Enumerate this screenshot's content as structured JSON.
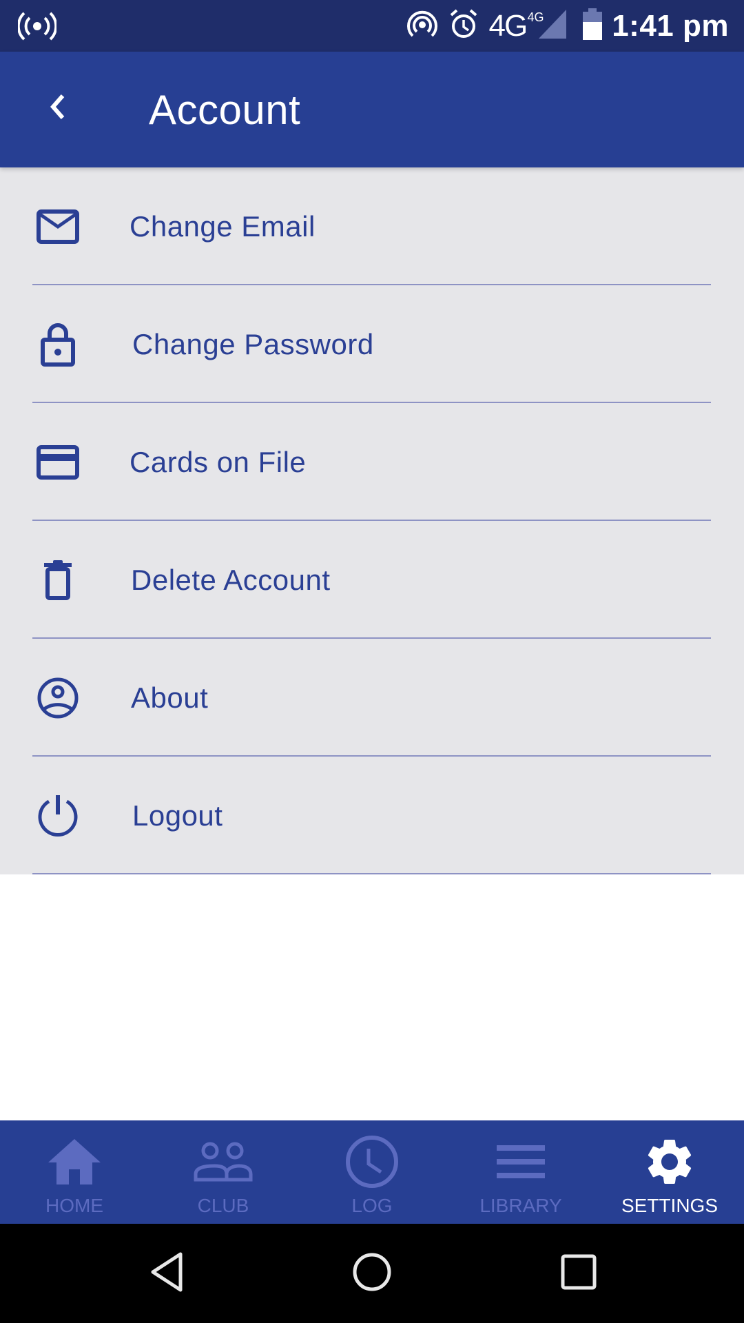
{
  "status_bar": {
    "time": "1:41 pm",
    "network": "4G",
    "network_sup": "4G",
    "icons": [
      "broadcast-icon",
      "hotspot-icon",
      "alarm-icon",
      "signal-icon",
      "battery-icon"
    ]
  },
  "app_bar": {
    "title": "Account",
    "back_icon": "chevron-left-icon"
  },
  "menu": {
    "items": [
      {
        "label": "Change Email",
        "icon": "mail-icon"
      },
      {
        "label": "Change Password",
        "icon": "lock-icon"
      },
      {
        "label": "Cards on File",
        "icon": "credit-card-icon"
      },
      {
        "label": "Delete Account",
        "icon": "trash-icon"
      },
      {
        "label": "About",
        "icon": "user-circle-icon"
      },
      {
        "label": "Logout",
        "icon": "power-icon"
      }
    ]
  },
  "bottom_nav": {
    "items": [
      {
        "label": "HOME",
        "icon": "home-icon",
        "active": false
      },
      {
        "label": "CLUB",
        "icon": "group-icon",
        "active": false
      },
      {
        "label": "LOG",
        "icon": "clock-icon",
        "active": false
      },
      {
        "label": "LIBRARY",
        "icon": "menu-lines-icon",
        "active": false
      },
      {
        "label": "SETTINGS",
        "icon": "gear-icon",
        "active": true
      }
    ]
  },
  "colors": {
    "status_bar": "#1f2d6a",
    "primary": "#273f93",
    "list_bg": "#e6e6e9",
    "text_accent": "#2a3f94",
    "nav_inactive": "#5c6bc0",
    "nav_active": "#ffffff"
  }
}
